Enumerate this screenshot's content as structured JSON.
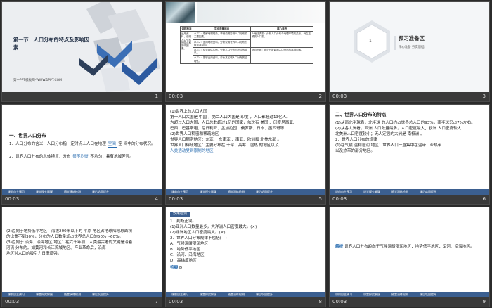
{
  "slides": [
    {
      "num": "1",
      "time": "",
      "title": "第一节　人口分布的特点及影响因素",
      "sub": "第一PPT模板网-WWW.1PPT.COM"
    },
    {
      "num": "2",
      "time": "00:03",
      "table_headers": [
        "课程标准",
        "学业质量标准",
        "核心素养"
      ],
      "table_rows": [
        [
          "运用资料，说明人口分布的特点和影响因素。",
          "水平1：理解地理现象，举例说明影响人口分布的主要因素。",
          "人地协调观：分析人口分布与地理环境的关系，树立正确的人口观。"
        ],
        [
          "",
          "水平2：运用地理资料，分析说明世界人口分布的特点及原因。",
          "综合思维：综合分析影响人口分布的各种因素。"
        ],
        [
          "",
          "水平3：结合具体实例，分析人口分布与环境的关系。",
          "区域认知：分析不同区域人口分布的差异。"
        ],
        [
          "",
          "水平4：能够运用资料，评价某区域人口分布的合理性。",
          ""
        ]
      ]
    },
    {
      "num": "3",
      "time": "00:03",
      "hex_num": "1",
      "section_title": "预习准备区",
      "section_sub": "精心准备  夯实基础"
    },
    {
      "num": "4",
      "time": "00:03",
      "heading": "一、世界人口分布",
      "p1a": "1．人口分布的含义：人口分布指一定时点上人口在地理",
      "p1b": "空间",
      "p1c": "空",
      "p1d": "间中的分布状况。",
      "p2a": "2．世界人口分布的总体特点：分布",
      "p2b": "很不均衡",
      "p2c": "不均匀，具有地域差异。",
      "footer": [
        "课前自主预习",
        "课堂探究解疑",
        "随堂演练检测",
        "课后巩固提升"
      ]
    },
    {
      "num": "5",
      "time": "00:03",
      "lines": [
        "(1)世界上的人口大国",
        "第一人口大国是 中国 ，第二人口大国是 印度 ，人口都超过13亿人。",
        "为超过人口大国，人口总数超过1亿的国家，依次有 美国 、印度尼西亚、",
        "巴西、巴基斯坦、尼日利亚、孟加拉国、俄罗斯、日本、墨西哥等",
        "(2)世界人口稠密和稀疏地区",
        "世界人口稠密地区：东亚、 东南亚 、南亚、欧洲和 北美东部 。",
        "世界人口稀疏地区：主要分布在 干旱、高寒、湿热 的地区以及",
        "人类活动受到限制的地区"
      ],
      "footer": [
        "课前自主预习",
        "课堂探究解疑",
        "随堂演练检测",
        "课后巩固提升"
      ]
    },
    {
      "num": "6",
      "time": "00:03",
      "heading": "二、世界人口分布的特点",
      "lines": [
        "(1)从南北半球看，北半球 的人口约占世界总人口的93%，南半球只占7%左右。",
        "(2)从各大洲看，亚洲 人口数量最多，人口密度最大；欧洲 人口密度较大，",
        "北美洲人口密度较小；无人定居的大洲是 南极洲 。",
        "2．世界人口分布的规律",
        "(1)在气候 温和湿润 地区：世界人口一直集中在温带、亚热带",
        "以及热带的部分地区。"
      ],
      "footer": [
        "课前自主预习",
        "课堂探究解疑",
        "随堂演练检测",
        "课后巩固提升"
      ]
    },
    {
      "num": "7",
      "time": "00:03",
      "lines": [
        "(2)趋向于地势低平地区：海拔200米以下的 平原 地区占地球陆地总面积",
        "的比重不到30%，分布的人口数量却占世界总人口的50%～60%。",
        "(3)趋向于 沿海、沿海地区 地区：在六千年前，人类最古老的文明是沿着",
        "河流 分布的。如黄河和长江流域地区。产业革命后，沿海",
        "地区对人口的吸引力日渐增强。"
      ],
      "footer": [
        "课前自主预习",
        "课堂探究解疑",
        "随堂演练检测",
        "课后巩固提升"
      ]
    },
    {
      "num": "8",
      "time": "00:03",
      "tag": "效果检测",
      "lines": [
        "1．判断正误。",
        "(1)亚洲人口数量最多，大洋洲人口密度最大。(×)",
        "(2)非洲地区人口密度最大。(×)",
        "2．世界人口分布规律不包括(　)",
        "A．气候温暖湿润地区",
        "B．地势低平地区",
        "C．沿河、沿海地区",
        "D．高纬度地区"
      ],
      "answer_label": "答案",
      "answer": "D",
      "footer": [
        "课前自主预习",
        "课堂探究解疑",
        "随堂演练检测",
        "课后巩固提升"
      ]
    },
    {
      "num": "9",
      "time": "00:03",
      "label": "解析",
      "text": "世界人口分布趋向于气候温暖湿润地区；地势低平地区；沿河、沿海地区。",
      "footer": [
        "课前自主预习",
        "课堂探究解疑",
        "随堂演练检测",
        "课后巩固提升"
      ]
    }
  ]
}
